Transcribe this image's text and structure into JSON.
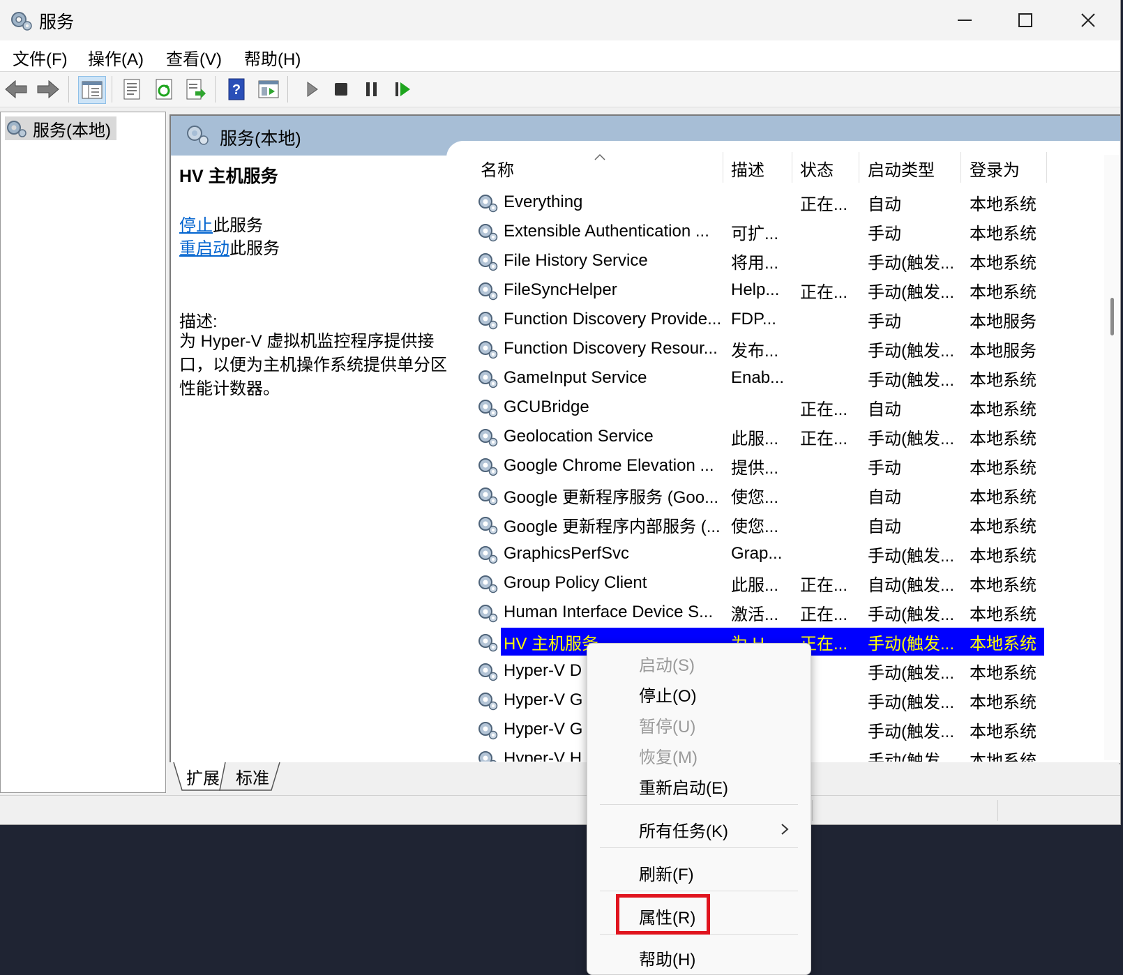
{
  "window": {
    "title": "服务",
    "icon": "gear-icon"
  },
  "menubar": {
    "items": [
      "文件(F)",
      "操作(A)",
      "查看(V)",
      "帮助(H)"
    ]
  },
  "toolbar": {
    "icons": [
      "back-arrow-icon",
      "forward-arrow-icon",
      "show-tree-icon",
      "properties-icon",
      "refresh-icon",
      "export-list-icon",
      "help-icon",
      "console-view-icon",
      "start-service-icon",
      "stop-service-icon",
      "pause-service-icon",
      "restart-service-icon"
    ]
  },
  "tree": {
    "root_label": "服务(本地)"
  },
  "main": {
    "header": "服务(本地)",
    "detail": {
      "title": "HV 主机服务",
      "stop_link": "停止",
      "stop_suffix": "此服务",
      "restart_link": "重启动",
      "restart_suffix": "此服务",
      "desc_label": "描述:",
      "desc_text": "为 Hyper-V 虚拟机监控程序提供接口，以便为主机操作系统提供单分区性能计数器。"
    },
    "columns": [
      "名称",
      "描述",
      "状态",
      "启动类型",
      "登录为"
    ],
    "rows": [
      {
        "name": "Everything",
        "desc": "",
        "status": "正在...",
        "startup": "自动",
        "logon": "本地系统"
      },
      {
        "name": "Extensible Authentication ...",
        "desc": "可扩...",
        "status": "",
        "startup": "手动",
        "logon": "本地系统"
      },
      {
        "name": "File History Service",
        "desc": "将用...",
        "status": "",
        "startup": "手动(触发...",
        "logon": "本地系统"
      },
      {
        "name": "FileSyncHelper",
        "desc": "Help...",
        "status": "正在...",
        "startup": "手动(触发...",
        "logon": "本地系统"
      },
      {
        "name": "Function Discovery Provide...",
        "desc": "FDP...",
        "status": "",
        "startup": "手动",
        "logon": "本地服务"
      },
      {
        "name": "Function Discovery Resour...",
        "desc": "发布...",
        "status": "",
        "startup": "手动(触发...",
        "logon": "本地服务"
      },
      {
        "name": "GameInput Service",
        "desc": "Enab...",
        "status": "",
        "startup": "手动(触发...",
        "logon": "本地系统"
      },
      {
        "name": "GCUBridge",
        "desc": "",
        "status": "正在...",
        "startup": "自动",
        "logon": "本地系统"
      },
      {
        "name": "Geolocation Service",
        "desc": "此服...",
        "status": "正在...",
        "startup": "手动(触发...",
        "logon": "本地系统"
      },
      {
        "name": "Google Chrome Elevation ...",
        "desc": "提供...",
        "status": "",
        "startup": "手动",
        "logon": "本地系统"
      },
      {
        "name": "Google 更新程序服务 (Goo...",
        "desc": "使您...",
        "status": "",
        "startup": "自动",
        "logon": "本地系统"
      },
      {
        "name": "Google 更新程序内部服务 (...",
        "desc": "使您...",
        "status": "",
        "startup": "自动",
        "logon": "本地系统"
      },
      {
        "name": "GraphicsPerfSvc",
        "desc": "Grap...",
        "status": "",
        "startup": "手动(触发...",
        "logon": "本地系统"
      },
      {
        "name": "Group Policy Client",
        "desc": "此服...",
        "status": "正在...",
        "startup": "自动(触发...",
        "logon": "本地系统"
      },
      {
        "name": "Human Interface Device S...",
        "desc": "激活...",
        "status": "正在...",
        "startup": "手动(触发...",
        "logon": "本地系统"
      },
      {
        "name": "HV 主机服务",
        "desc": "为 H...",
        "status": "正在...",
        "startup": "手动(触发...",
        "logon": "本地系统"
      },
      {
        "name": "Hyper-V D",
        "desc": "",
        "status": "",
        "startup": "手动(触发...",
        "logon": "本地系统"
      },
      {
        "name": "Hyper-V G",
        "desc": "",
        "status": "",
        "startup": "手动(触发...",
        "logon": "本地系统"
      },
      {
        "name": "Hyper-V G",
        "desc": "",
        "status": "",
        "startup": "手动(触发...",
        "logon": "本地系统"
      },
      {
        "name": "Hyper-V H",
        "desc": "",
        "status": "",
        "startup": "手动(触发",
        "logon": "本地系统"
      }
    ],
    "selected_index": 15
  },
  "tabs": [
    "扩展",
    "标准"
  ],
  "context_menu": {
    "start": "启动(S)",
    "stop": "停止(O)",
    "pause": "暂停(U)",
    "resume": "恢复(M)",
    "restart": "重新启动(E)",
    "all_tasks": "所有任务(K)",
    "refresh": "刷新(F)",
    "properties": "属性(R)",
    "help": "帮助(H)"
  },
  "colors": {
    "selection_bg": "#0000ff",
    "selection_fg": "#ffff00",
    "link": "#0063cf",
    "highlight": "#e0141e",
    "header_bg": "#a7bed6"
  }
}
